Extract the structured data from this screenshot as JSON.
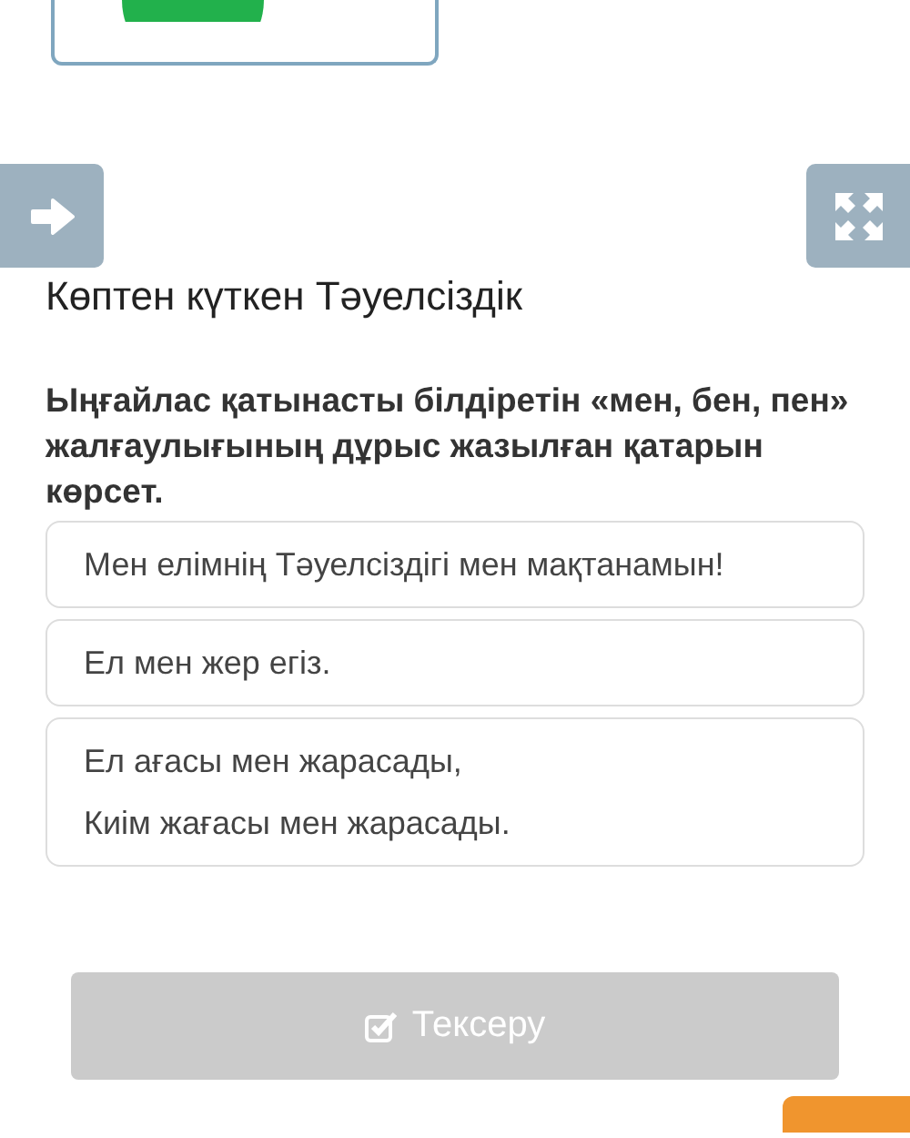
{
  "title": "Көптен күткен Тәуелсіздік",
  "question": "Ыңғайлас қатынасты білдіретін «мен, бен, пен» жалғаулығының дұрыс жазылған қатарын көрсет.",
  "options": [
    {
      "lines": [
        "Мен елімнің Тәуелсіздігі мен мақтанамын!"
      ]
    },
    {
      "lines": [
        "Ел мен жер егіз."
      ]
    },
    {
      "lines": [
        "Ел ағасы мен жарасады,",
        "Киім жағасы мен жарасады."
      ]
    }
  ],
  "check_button": {
    "label": "Тексеру",
    "disabled": true
  }
}
